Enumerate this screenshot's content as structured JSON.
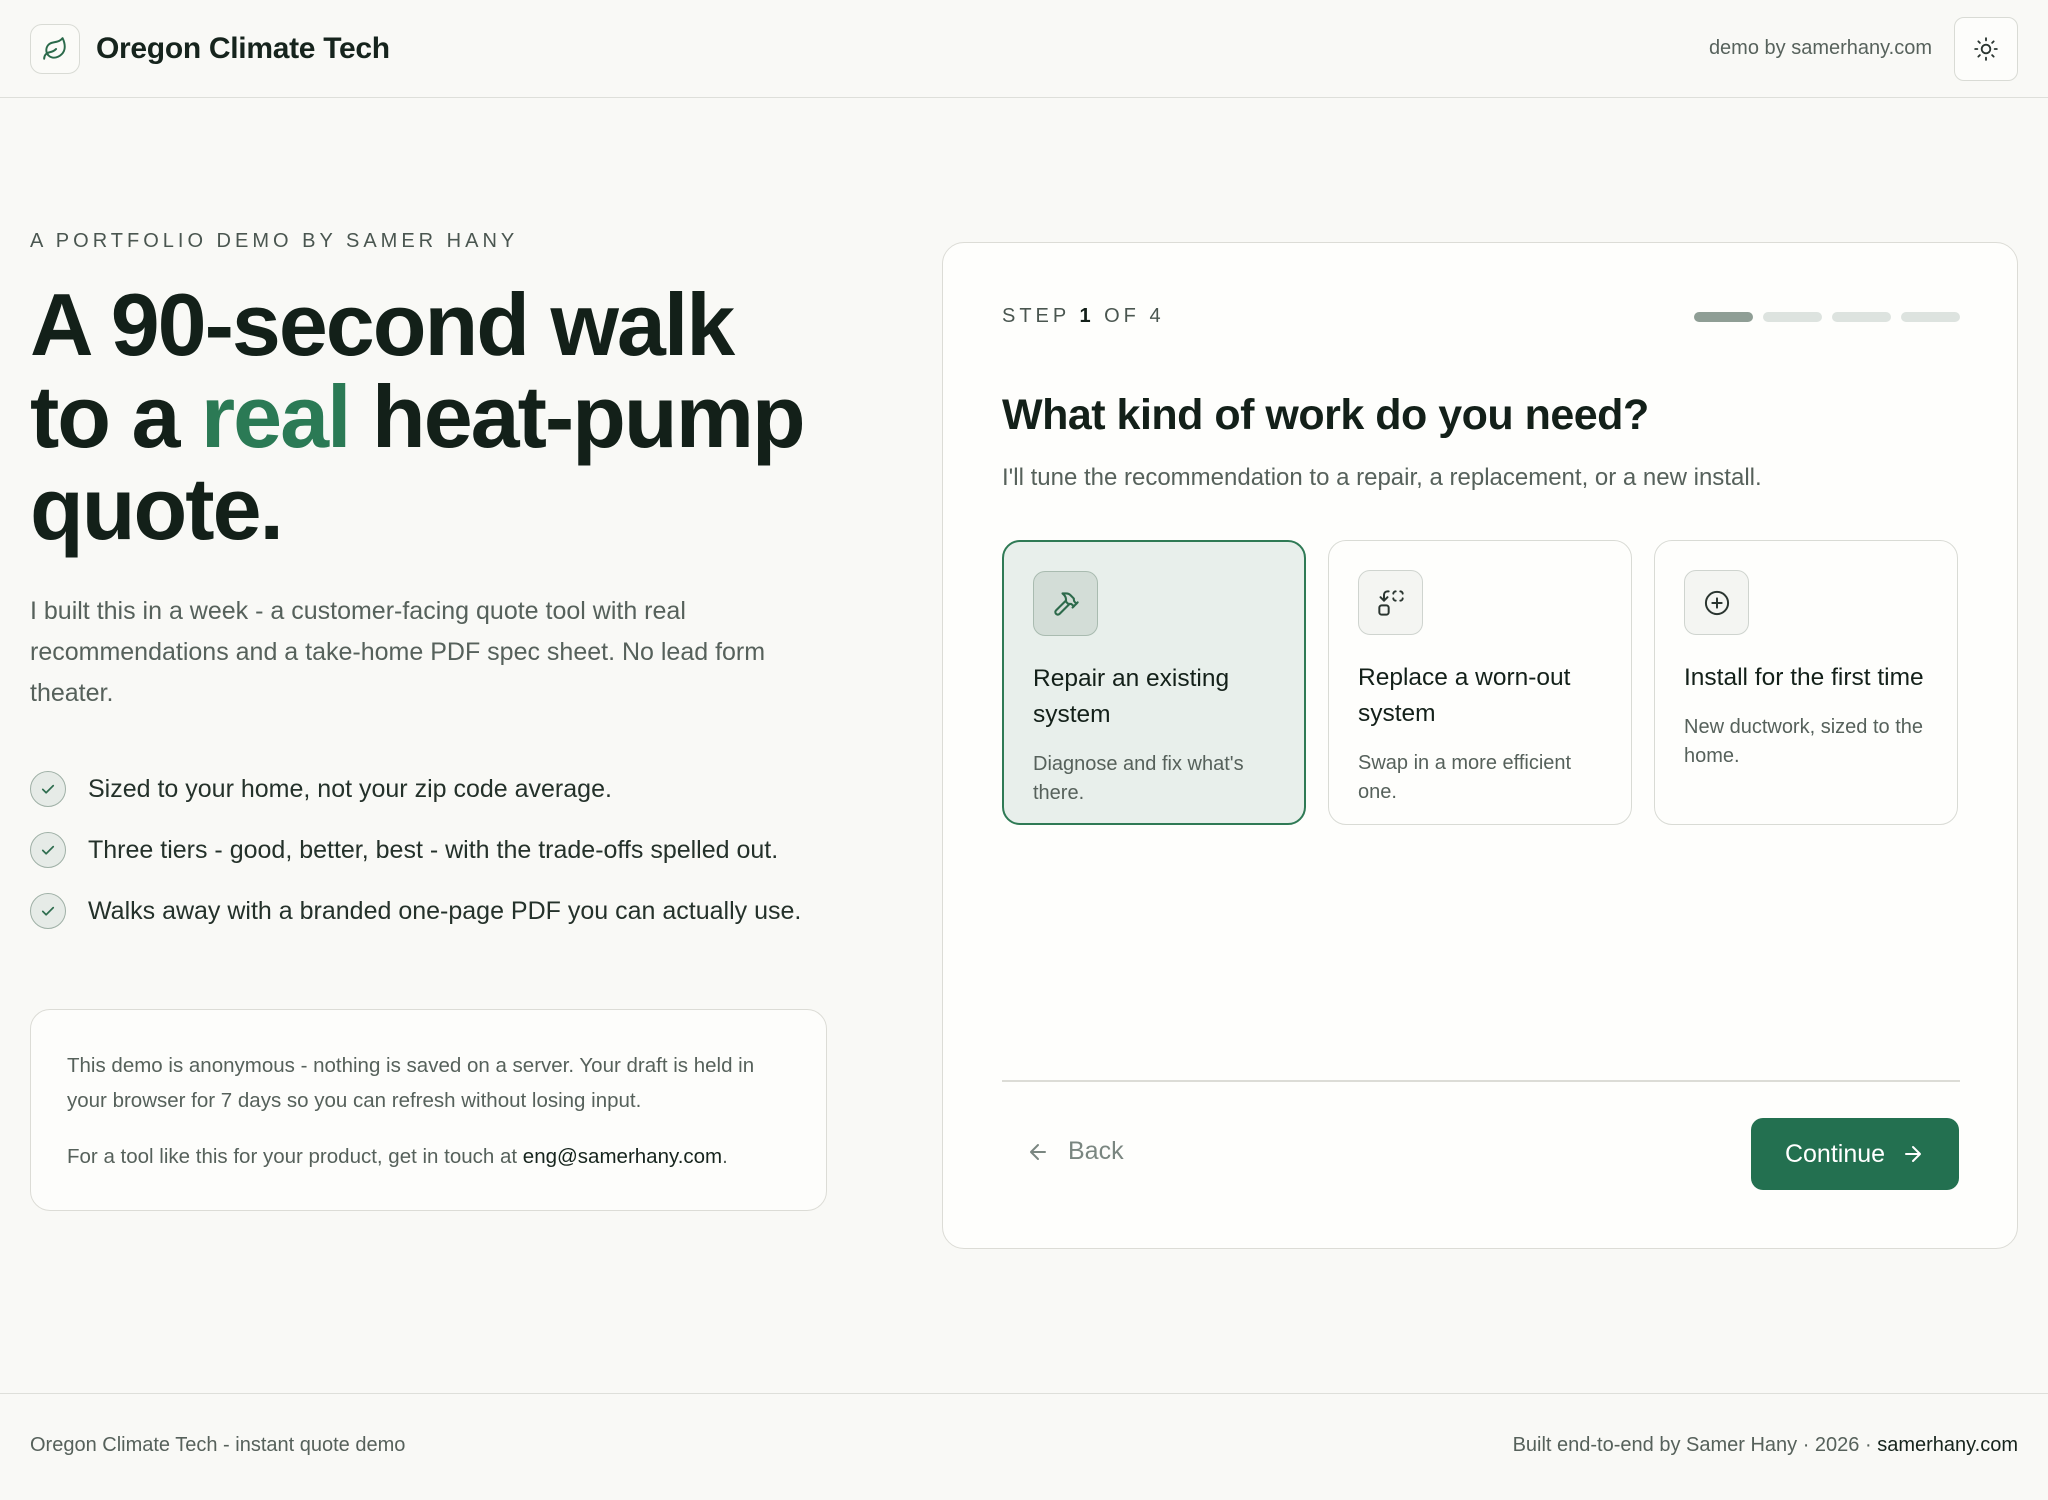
{
  "header": {
    "brand_name": "Oregon Climate Tech",
    "logo_icon": "leaf-icon",
    "demo_by": "demo by samerhany.com",
    "theme_icon": "sun-icon"
  },
  "hero": {
    "eyebrow": "A PORTFOLIO DEMO BY SAMER HANY",
    "headline_line1": "A 90-second walk",
    "headline_line2_pre": "to a ",
    "headline_line2_accent": "real",
    "headline_line2_post": " heat-pump",
    "headline_line3": "quote.",
    "lede": "I built this in a week - a customer-facing quote tool with real recommendations and a take-home PDF spec sheet. No lead form theater.",
    "bullets": [
      "Sized to your home, not your zip code average.",
      "Three tiers - good, better, best - with the trade-offs spelled out.",
      "Walks away with a branded one-page PDF you can actually use."
    ]
  },
  "note": {
    "privacy": "This demo is anonymous - nothing is saved on a server. Your draft is held in your browser for 7 days so you can refresh without losing input.",
    "contact_pre": "For a tool like this for your product, get in touch at ",
    "contact_email": "eng@samerhany.com",
    "contact_post": "."
  },
  "wizard": {
    "step_prefix": "STEP",
    "step_current": "1",
    "step_of": "OF",
    "step_total": "4",
    "progress_active": 1,
    "progress_total": 4,
    "question": "What kind of work do you need?",
    "subtitle": "I'll tune the recommendation to a repair, a replacement, or a new install.",
    "options": [
      {
        "title": "Repair an existing system",
        "desc": "Diagnose and fix what's there.",
        "icon": "hammer-icon",
        "selected": true
      },
      {
        "title": "Replace a worn-out system",
        "desc": "Swap in a more efficient one.",
        "icon": "swap-icon",
        "selected": false
      },
      {
        "title": "Install for the first time",
        "desc": "New ductwork, sized to the home.",
        "icon": "plus-circle-icon",
        "selected": false
      }
    ],
    "back_label": "Back",
    "continue_label": "Continue"
  },
  "colors": {
    "accent": "#2b7a55",
    "button": "#237050",
    "background": "#f9f9f6"
  },
  "footer": {
    "left": "Oregon Climate Tech - instant quote demo",
    "right_pre": "Built end-to-end by Samer Hany · 2026 · ",
    "right_site": "samerhany.com"
  }
}
